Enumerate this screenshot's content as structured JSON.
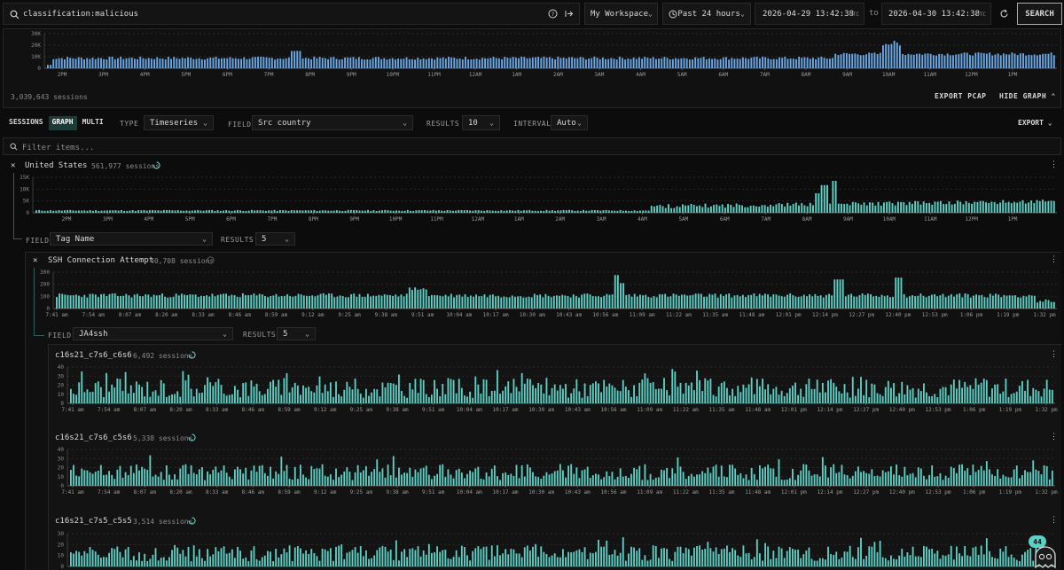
{
  "colors": {
    "accent": "#5ecfc4",
    "bars_top": "#6aa8e6",
    "bars_teal": "#5ecfc4",
    "bg": "#0c0c0c",
    "panel": "#141414"
  },
  "search": {
    "query": "classification:malicious",
    "icons": [
      "search-icon",
      "help-icon",
      "exit-arrow-icon"
    ]
  },
  "header": {
    "workspace": "My Workspace",
    "range": "Past 24 hours",
    "from": "2026-04-29 13:42:38",
    "to_word": "to",
    "to": "2026-04-30 13:42:38",
    "tz": "UTC",
    "search_button": "SEARCH"
  },
  "overview": {
    "sessions_text": "3,039,643 sessions",
    "export_pcap": "EXPORT PCAP",
    "hide_graph": "HIDE GRAPH",
    "y_ticks": [
      "30K",
      "20K",
      "10K",
      "0"
    ],
    "x_ticks": [
      "2PM",
      "3PM",
      "4PM",
      "5PM",
      "6PM",
      "7PM",
      "8PM",
      "9PM",
      "10PM",
      "11PM",
      "12AM",
      "1AM",
      "2AM",
      "3AM",
      "4AM",
      "5AM",
      "6AM",
      "7AM",
      "8AM",
      "9AM",
      "10AM",
      "11AM",
      "12PM",
      "1PM"
    ]
  },
  "toolbar": {
    "tabs": [
      "SESSIONS",
      "GRAPH",
      "MULTI"
    ],
    "active_tab": "GRAPH",
    "type_label": "TYPE",
    "type_value": "Timeseries",
    "field_label": "FIELD",
    "field_value": "Src country",
    "results_label": "RESULTS",
    "results_value": "10",
    "interval_label": "INTERVAL",
    "interval_value": "Auto",
    "export": "EXPORT"
  },
  "filter": {
    "placeholder": "Filter items..."
  },
  "country": {
    "name": "United States",
    "sessions": "561,977 sessions",
    "y_ticks": [
      "15K",
      "10K",
      "5K",
      "0"
    ],
    "x_ticks": [
      "2PM",
      "3PM",
      "4PM",
      "5PM",
      "6PM",
      "7PM",
      "8PM",
      "9PM",
      "10PM",
      "11PM",
      "12AM",
      "1AM",
      "2AM",
      "3AM",
      "4AM",
      "5AM",
      "6AM",
      "7AM",
      "8AM",
      "9AM",
      "10AM",
      "11AM",
      "12PM",
      "1PM"
    ],
    "field_label": "FIELD",
    "field_value": "Tag Name",
    "results_label": "RESULTS",
    "results_value": "5"
  },
  "tag": {
    "name": "SSH Connection Attempt",
    "sessions": "40,708 sessions",
    "y_ticks": [
      "300",
      "200",
      "100",
      "0"
    ],
    "x_ticks": [
      "7:41 am",
      "7:54 am",
      "8:07 am",
      "8:20 am",
      "8:33 am",
      "8:46 am",
      "8:59 am",
      "9:12 am",
      "9:25 am",
      "9:38 am",
      "9:51 am",
      "10:04 am",
      "10:17 am",
      "10:30 am",
      "10:43 am",
      "10:56 am",
      "11:09 am",
      "11:22 am",
      "11:35 am",
      "11:48 am",
      "12:01 pm",
      "12:14 pm",
      "12:27 pm",
      "12:40 pm",
      "12:53 pm",
      "1:06 pm",
      "1:19 pm",
      "1:32 pm"
    ],
    "field_label": "FIELD",
    "field_value": "JA4ssh",
    "results_label": "RESULTS",
    "results_value": "5"
  },
  "fingerprints": [
    {
      "name": "c16s21_c7s6_c6s6",
      "sessions": "6,492 sessions",
      "y_ticks": [
        "40",
        "30",
        "20",
        "10",
        "0"
      ]
    },
    {
      "name": "c16s21_c7s6_c5s6",
      "sessions": "5,338 sessions",
      "y_ticks": [
        "40",
        "30",
        "20",
        "10",
        "0"
      ]
    },
    {
      "name": "c16s21_c7s5_c5s5",
      "sessions": "3,514 sessions",
      "y_ticks": [
        "30",
        "20",
        "10",
        "0"
      ]
    }
  ],
  "fp_x_ticks": [
    "7:41 am",
    "7:54 am",
    "8:07 am",
    "8:20 am",
    "8:33 am",
    "8:46 am",
    "8:59 am",
    "9:12 am",
    "9:25 am",
    "9:38 am",
    "9:51 am",
    "10:04 am",
    "10:17 am",
    "10:30 am",
    "10:43 am",
    "10:56 am",
    "11:09 am",
    "11:22 am",
    "11:35 am",
    "11:48 am",
    "12:01 pm",
    "12:14 pm",
    "12:27 pm",
    "12:40 pm",
    "12:53 pm",
    "1:06 pm",
    "1:19 pm",
    "1:32 pm"
  ],
  "badge": {
    "count": "44"
  }
}
